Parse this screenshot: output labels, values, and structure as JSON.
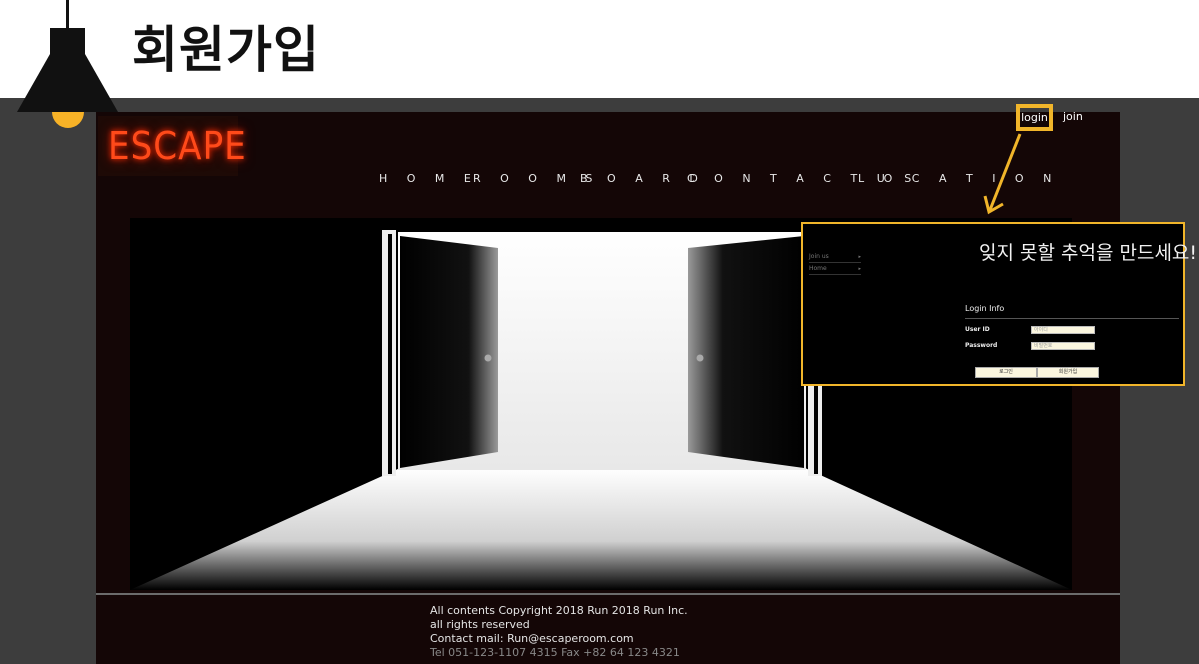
{
  "slide": {
    "title": "회원가입"
  },
  "site": {
    "logo": "ESCAPE",
    "nav": [
      "H O M E",
      "R O O M S",
      "B O A R D",
      "C O N T A C T   U S",
      "L O C A T I O N"
    ],
    "top_links": {
      "login": "login",
      "join": "join"
    }
  },
  "panel": {
    "menu": [
      {
        "label": "Join us",
        "arrow": "▸"
      },
      {
        "label": "Home",
        "arrow": "▸"
      }
    ],
    "headline": "잊지 못할 추억을 만드세요!",
    "login_info": "Login Info",
    "fields": [
      {
        "label": "User ID",
        "placeholder": "아이디"
      },
      {
        "label": "Password",
        "placeholder": "비밀번호"
      }
    ],
    "buttons": {
      "login": "로그인",
      "signup": "회원가입"
    }
  },
  "footer": {
    "lines": [
      "All contents Copyright 2018 Run 2018 Run Inc.",
      "all rights reserved",
      "Contact mail: Run@escaperoom.com",
      "Tel 051-123-1107 4315 Fax +82 64 123 4321"
    ]
  },
  "colors": {
    "accent": "#f1b52a",
    "neon": "#ff4a1a",
    "background": "#3d3d3d"
  }
}
